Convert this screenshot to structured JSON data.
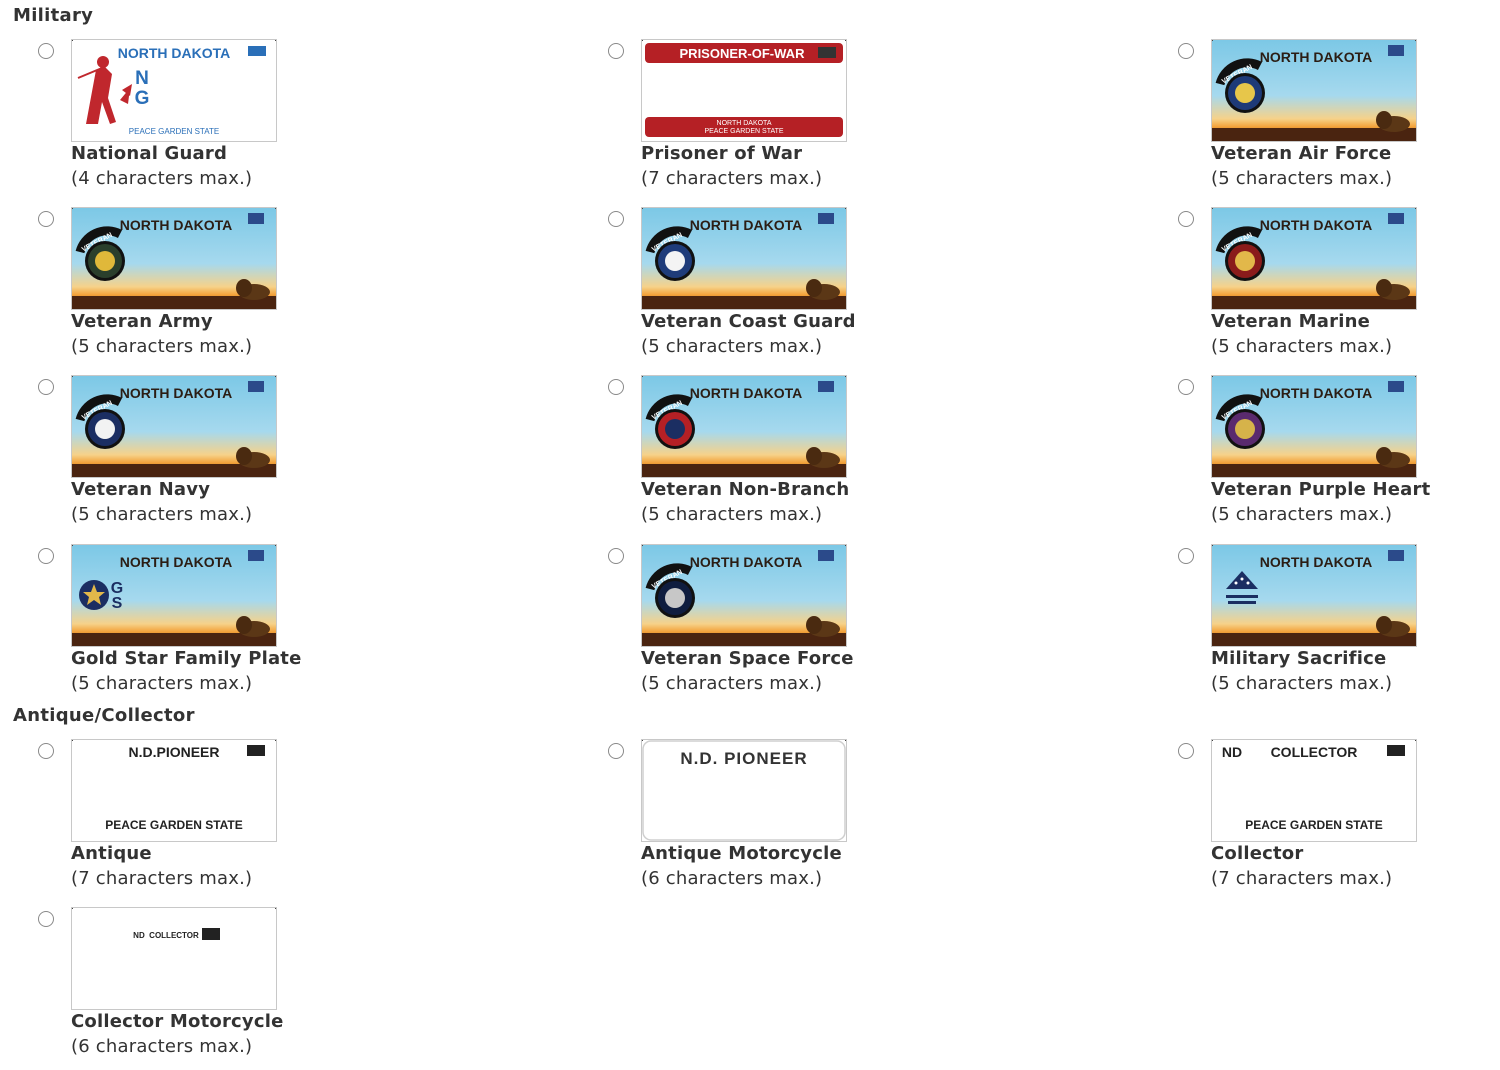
{
  "sections": {
    "military": "Military",
    "antique": "Antique/Collector"
  },
  "plates": [
    {
      "name": "National Guard",
      "max": "(4 characters max.)",
      "plate_text": {
        "top": "NORTH DAKOTA",
        "line1": "N",
        "line2": "G",
        "bottom": "PEACE GARDEN STATE"
      },
      "icon": "national-guard-minuteman-icon"
    },
    {
      "name": "Prisoner of War",
      "max": "(7 characters max.)",
      "plate_text": {
        "top": "PRISONER-OF-WAR",
        "bottom1": "NORTH DAKOTA",
        "bottom2": "PEACE GARDEN STATE"
      },
      "icon": "pow-emblem-icon"
    },
    {
      "name": "Veteran Air Force",
      "max": "(5 characters max.)",
      "plate_text": {
        "top": "NORTH DAKOTA",
        "arc": "VETERAN"
      },
      "icon": "air-force-seal-icon"
    },
    {
      "name": "Veteran Army",
      "max": "(5 characters max.)",
      "plate_text": {
        "top": "NORTH DAKOTA",
        "arc": "VETERAN"
      },
      "icon": "army-seal-icon"
    },
    {
      "name": "Veteran Coast Guard",
      "max": "(5 characters max.)",
      "plate_text": {
        "top": "NORTH DAKOTA",
        "arc": "VETERAN"
      },
      "icon": "coast-guard-seal-icon"
    },
    {
      "name": "Veteran Marine",
      "max": "(5 characters max.)",
      "plate_text": {
        "top": "NORTH DAKOTA",
        "arc": "VETERAN"
      },
      "icon": "marine-seal-icon"
    },
    {
      "name": "Veteran Navy",
      "max": "(5 characters max.)",
      "plate_text": {
        "top": "NORTH DAKOTA",
        "arc": "VETERAN"
      },
      "icon": "navy-seal-icon"
    },
    {
      "name": "Veteran Non-Branch",
      "max": "(5 characters max.)",
      "plate_text": {
        "top": "NORTH DAKOTA",
        "arc": "VETERAN"
      },
      "icon": "eagle-flag-icon"
    },
    {
      "name": "Veteran Purple Heart",
      "max": "(5 characters max.)",
      "plate_text": {
        "top": "NORTH DAKOTA",
        "arc": "VETERAN"
      },
      "icon": "purple-heart-icon"
    },
    {
      "name": "Gold Star Family Plate",
      "max": "(5 characters max.)",
      "plate_text": {
        "top": "NORTH DAKOTA",
        "line1": "G",
        "line2": "S"
      },
      "icon": "gold-star-icon"
    },
    {
      "name": "Veteran Space Force",
      "max": "(5 characters max.)",
      "plate_text": {
        "top": "NORTH DAKOTA",
        "arc": "VETERAN"
      },
      "icon": "space-force-seal-icon"
    },
    {
      "name": "Military Sacrifice",
      "max": "(5 characters max.)",
      "plate_text": {
        "top": "NORTH DAKOTA"
      },
      "icon": "folded-flag-icon"
    },
    {
      "name": "Antique",
      "max": "(7 characters max.)",
      "plate_text": {
        "top": "N.D.PIONEER",
        "bottom": "PEACE GARDEN STATE"
      },
      "icon": "sticker-icon"
    },
    {
      "name": "Antique Motorcycle",
      "max": "(6 characters max.)",
      "plate_text": {
        "top": "N.D. PIONEER"
      },
      "icon": ""
    },
    {
      "name": "Collector",
      "max": "(7 characters max.)",
      "plate_text": {
        "left": "ND",
        "top": "COLLECTOR",
        "bottom": "PEACE GARDEN STATE"
      },
      "icon": "sticker-icon"
    },
    {
      "name": "Collector Motorcycle",
      "max": "(6 characters max.)",
      "plate_text": {
        "top": "ND  COLLECTOR"
      },
      "icon": "sticker-icon"
    }
  ],
  "colors": {
    "sky_top": "#7cc8e6",
    "sky_mid": "#a6d9ee",
    "horizon": "#f3a23a",
    "ground": "#7a3a14",
    "pow_red": "#b52025",
    "ng_blue": "#2a6fb8",
    "ng_red": "#c0272d"
  }
}
